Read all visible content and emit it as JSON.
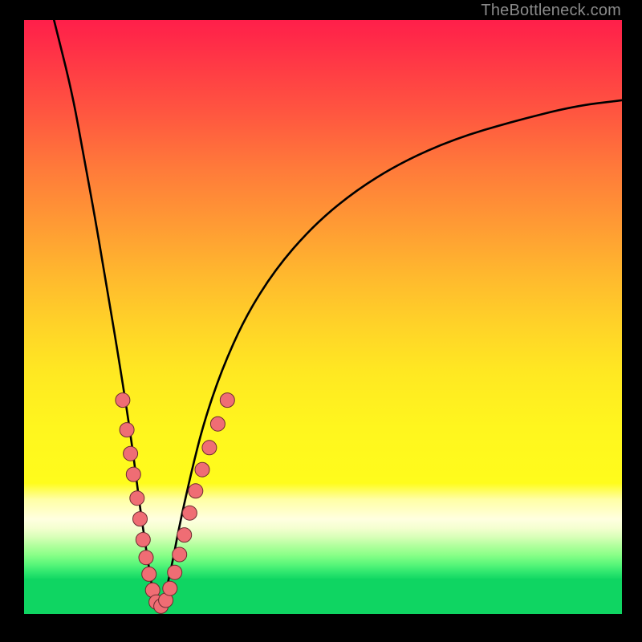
{
  "watermark": "TheBottleneck.com",
  "colors": {
    "frame": "#000000",
    "curve": "#000000",
    "dots_fill": "#ef6d74",
    "dots_stroke": "#6b2b2f",
    "gradient_top": "#ff1f4a",
    "gradient_mid": "#ffe822",
    "gradient_bottom": "#0fd562"
  },
  "chart_data": {
    "type": "line",
    "title": "",
    "xlabel": "",
    "ylabel": "",
    "xlim": [
      0,
      100
    ],
    "ylim": [
      0,
      100
    ],
    "grid": false,
    "legend": false,
    "description": "Single V-shaped bottleneck curve over a vertical traffic-light gradient. X axis is relative component balance; Y axis is bottleneck severity (high = red, low = green). The curve dips to ~0 around x≈22 and rises on both sides; the right arm rises more slowly than the left.",
    "series": [
      {
        "name": "bottleneck-severity",
        "x": [
          5,
          8,
          10,
          12,
          14,
          16,
          18,
          19.5,
          21,
          22,
          23,
          24.5,
          26,
          28,
          30,
          33,
          37,
          42,
          48,
          55,
          63,
          72,
          82,
          92,
          100
        ],
        "y": [
          100,
          88,
          77,
          66,
          54,
          42,
          29,
          17,
          7,
          1,
          1,
          7,
          15,
          24,
          32,
          41,
          50,
          58,
          65,
          71,
          76,
          80,
          83,
          85.5,
          86.5
        ]
      }
    ],
    "marker_points": [
      {
        "x": 16.5,
        "y": 36
      },
      {
        "x": 17.2,
        "y": 31
      },
      {
        "x": 17.8,
        "y": 27
      },
      {
        "x": 18.3,
        "y": 23.5
      },
      {
        "x": 18.9,
        "y": 19.5
      },
      {
        "x": 19.4,
        "y": 16
      },
      {
        "x": 19.9,
        "y": 12.5
      },
      {
        "x": 20.4,
        "y": 9.5
      },
      {
        "x": 20.9,
        "y": 6.7
      },
      {
        "x": 21.5,
        "y": 4
      },
      {
        "x": 22.1,
        "y": 2
      },
      {
        "x": 22.9,
        "y": 1.3
      },
      {
        "x": 23.7,
        "y": 2.3
      },
      {
        "x": 24.4,
        "y": 4.3
      },
      {
        "x": 25.2,
        "y": 7
      },
      {
        "x": 26.0,
        "y": 10
      },
      {
        "x": 26.8,
        "y": 13.3
      },
      {
        "x": 27.7,
        "y": 17
      },
      {
        "x": 28.7,
        "y": 20.7
      },
      {
        "x": 29.8,
        "y": 24.3
      },
      {
        "x": 31.0,
        "y": 28
      },
      {
        "x": 32.4,
        "y": 32
      },
      {
        "x": 34.0,
        "y": 36
      }
    ]
  }
}
